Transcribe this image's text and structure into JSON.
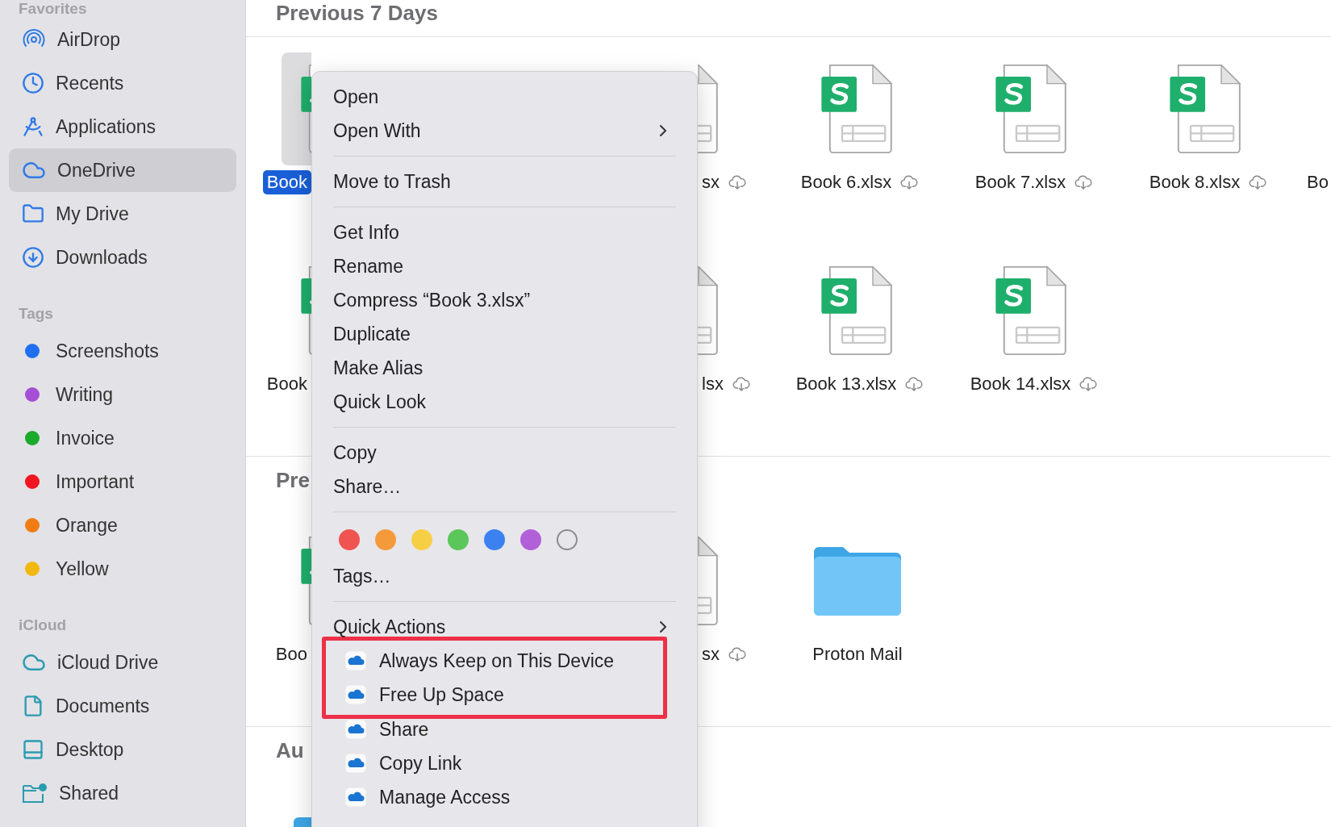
{
  "sidebar": {
    "sections": [
      {
        "kind": "places",
        "header": "Favorites",
        "items": [
          {
            "label": "AirDrop",
            "selected": false
          },
          {
            "label": "Recents",
            "selected": false
          },
          {
            "label": "Applications",
            "selected": false
          },
          {
            "label": "OneDrive",
            "selected": true
          },
          {
            "label": "My Drive",
            "selected": false
          },
          {
            "label": "Downloads",
            "selected": false
          }
        ]
      },
      {
        "kind": "tags",
        "header": "Tags",
        "items": [
          {
            "label": "Screenshots",
            "color": "#1f6ff0"
          },
          {
            "label": "Writing",
            "color": "#a64fd6"
          },
          {
            "label": "Invoice",
            "color": "#1aaa2c"
          },
          {
            "label": "Important",
            "color": "#f01520"
          },
          {
            "label": "Orange",
            "color": "#f07d14"
          },
          {
            "label": "Yellow",
            "color": "#f3b80f"
          }
        ]
      },
      {
        "kind": "places",
        "header": "iCloud",
        "items": [
          {
            "label": "iCloud Drive",
            "selected": false
          },
          {
            "label": "Documents",
            "selected": false
          },
          {
            "label": "Desktop",
            "selected": false
          },
          {
            "label": "Shared",
            "selected": false
          }
        ]
      }
    ]
  },
  "main": {
    "sections": [
      {
        "header": "Previous 7 Days",
        "rows": [
          {
            "peek_before": {
              "kind": "sheet",
              "label": "Book",
              "selected": true
            },
            "peek_after": {
              "kind": "sheet",
              "label": "sx",
              "selected": false,
              "cloud": true
            },
            "tiles": [
              {
                "kind": "sheet",
                "label": "Book 6.xlsx",
                "selected": false,
                "cloud": true
              },
              {
                "kind": "sheet",
                "label": "Book 7.xlsx",
                "selected": false,
                "cloud": true
              },
              {
                "kind": "sheet",
                "label": "Book 8.xlsx",
                "selected": false,
                "cloud": true
              }
            ],
            "peek_edge": {
              "label": "Bo"
            }
          },
          {
            "peek_before": {
              "kind": "sheet",
              "label": "Book",
              "selected": false
            },
            "peek_after": {
              "kind": "sheet",
              "label": "lsx",
              "selected": false,
              "cloud": true
            },
            "tiles": [
              {
                "kind": "sheet",
                "label": "Book 13.xlsx",
                "selected": false,
                "cloud": true
              },
              {
                "kind": "sheet",
                "label": "Book 14.xlsx",
                "selected": false,
                "cloud": true
              }
            ]
          }
        ]
      },
      {
        "header": "Pre",
        "rows": [
          {
            "peek_before": {
              "kind": "sheet",
              "label": "Boo",
              "selected": false
            },
            "peek_after": {
              "kind": "sheet",
              "label": "sx",
              "selected": false,
              "cloud": true
            },
            "tiles": [
              {
                "kind": "folder",
                "label": "Proton Mail",
                "selected": false,
                "cloud": false
              }
            ]
          }
        ]
      },
      {
        "header": "Au",
        "rows": [
          {
            "peek_before": {
              "kind": "folder"
            },
            "tiles": []
          }
        ]
      }
    ]
  },
  "context_menu": {
    "groups": [
      [
        {
          "kind": "plain",
          "label": "Open",
          "submenu": false
        },
        {
          "kind": "plain",
          "label": "Open With",
          "submenu": true
        }
      ],
      [
        {
          "kind": "plain",
          "label": "Move to Trash",
          "submenu": false
        }
      ],
      [
        {
          "kind": "plain",
          "label": "Get Info",
          "submenu": false
        },
        {
          "kind": "plain",
          "label": "Rename",
          "submenu": false
        },
        {
          "kind": "plain",
          "label": "Compress “Book 3.xlsx”",
          "submenu": false
        },
        {
          "kind": "plain",
          "label": "Duplicate",
          "submenu": false
        },
        {
          "kind": "plain",
          "label": "Make Alias",
          "submenu": false
        },
        {
          "kind": "plain",
          "label": "Quick Look",
          "submenu": false
        }
      ],
      [
        {
          "kind": "plain",
          "label": "Copy",
          "submenu": false
        },
        {
          "kind": "plain",
          "label": "Share…",
          "submenu": false
        }
      ],
      [
        {
          "kind": "swatches",
          "swatches": [
            {
              "kind": "fill",
              "color": "#f05450"
            },
            {
              "kind": "fill",
              "color": "#f59a3b"
            },
            {
              "kind": "fill",
              "color": "#f7cf45"
            },
            {
              "kind": "fill",
              "color": "#5bc65a"
            },
            {
              "kind": "fill",
              "color": "#3b82f0"
            },
            {
              "kind": "fill",
              "color": "#b260d8"
            },
            {
              "kind": "clear"
            }
          ]
        },
        {
          "kind": "plain",
          "label": "Tags…",
          "submenu": false
        }
      ],
      [
        {
          "kind": "plain",
          "label": "Quick Actions",
          "submenu": true
        },
        {
          "kind": "cloud",
          "label": "Always Keep on This Device",
          "outlined": true
        },
        {
          "kind": "cloud",
          "label": "Free Up Space",
          "outlined": true
        },
        {
          "kind": "cloud",
          "label": "Share",
          "outlined": false
        },
        {
          "kind": "cloud",
          "label": "Copy Link",
          "outlined": false
        },
        {
          "kind": "cloud",
          "label": "Manage Access",
          "outlined": false
        }
      ]
    ]
  }
}
